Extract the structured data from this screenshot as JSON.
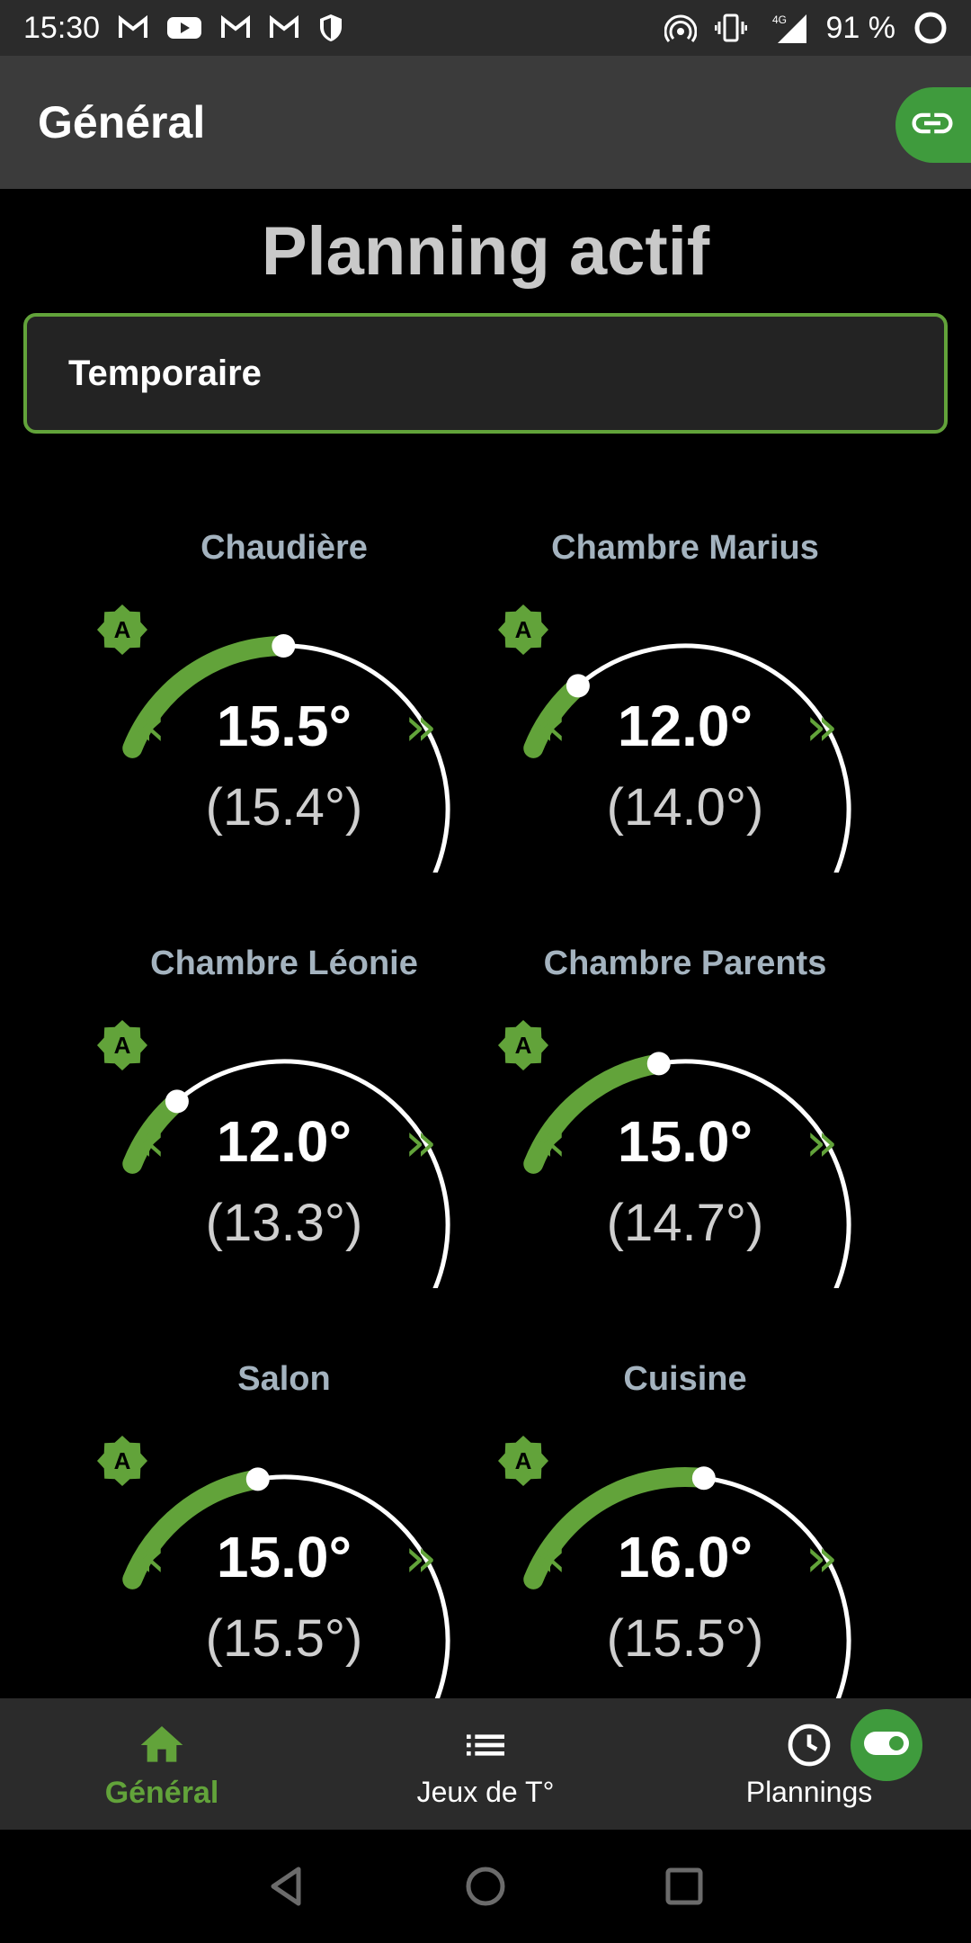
{
  "status_bar": {
    "time": "15:30",
    "notification_icons": [
      "gmail-icon",
      "youtube-icon",
      "gmail-icon",
      "gmail-icon",
      "shield-icon"
    ],
    "network": "4G",
    "battery": "91 %"
  },
  "app_bar": {
    "title": "Général",
    "link_icon": "link-icon"
  },
  "planning": {
    "title": "Planning actif",
    "selected": "Temporaire"
  },
  "rooms": [
    {
      "name": "Chaudière",
      "setpoint": "15.5°",
      "measured": "(15.4°)",
      "level": 0.3,
      "mode": "A"
    },
    {
      "name": "Chambre Marius",
      "setpoint": "12.0°",
      "measured": "(14.0°)",
      "level": 0.12,
      "mode": "A"
    },
    {
      "name": "Chambre Léonie",
      "setpoint": "12.0°",
      "measured": "(13.3°)",
      "level": 0.12,
      "mode": "A"
    },
    {
      "name": "Chambre Parents",
      "setpoint": "15.0°",
      "measured": "(14.7°)",
      "level": 0.26,
      "mode": "A"
    },
    {
      "name": "Salon",
      "setpoint": "15.0°",
      "measured": "(15.5°)",
      "level": 0.26,
      "mode": "A"
    },
    {
      "name": "Cuisine",
      "setpoint": "16.0°",
      "measured": "(15.5°)",
      "level": 0.33,
      "mode": "A"
    }
  ],
  "arrows": {
    "minus": "«",
    "plus": "»"
  },
  "bottom_nav": [
    {
      "label": "Général",
      "icon": "home-icon",
      "active": true
    },
    {
      "label": "Jeux de T°",
      "icon": "list-icon",
      "active": false
    },
    {
      "label": "Plannings",
      "icon": "clock-icon",
      "active": false
    }
  ],
  "colors": {
    "accent": "#62a33a",
    "fab": "#3f9b3d",
    "appbar": "#3b3b3b",
    "background": "#000000"
  }
}
